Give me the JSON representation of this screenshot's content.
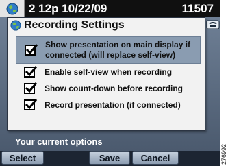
{
  "status_bar": {
    "datetime": "2 12p 10/22/09",
    "extension": "11507",
    "globe_icon": "globe-icon"
  },
  "header": {
    "phone_icon": "phone-handset-icon"
  },
  "dialog": {
    "title": "Recording Settings",
    "options": [
      {
        "label": "Show presentation on main display if connected (will replace self-view)",
        "checked": true,
        "selected": true
      },
      {
        "label": "Enable self-view when recording",
        "checked": true,
        "selected": false
      },
      {
        "label": "Show count-down before recording",
        "checked": true,
        "selected": false
      },
      {
        "label": "Record presentation (if connected)",
        "checked": true,
        "selected": false
      }
    ]
  },
  "hint": "Your current options",
  "softkeys": {
    "select": "Select",
    "save": "Save",
    "cancel": "Cancel"
  },
  "figure_id": "276992",
  "colors": {
    "background": "#5e6f86",
    "selected_row": "#8a9cb1",
    "status_bar": "#101010"
  }
}
